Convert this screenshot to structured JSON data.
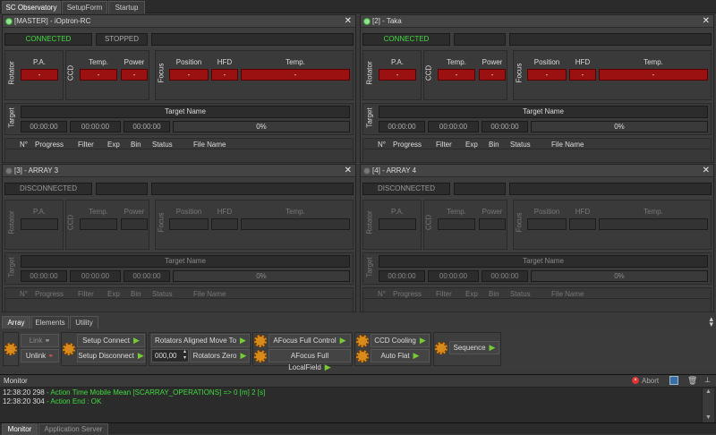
{
  "tabs": [
    "SC Observatory",
    "SetupForm",
    "Startup"
  ],
  "panels": [
    {
      "title": "[MASTER] - iOptron-RC",
      "status": "CONNECTED",
      "state": "STOPPED",
      "connected": true
    },
    {
      "title": "[2] - Taka",
      "status": "CONNECTED",
      "state": "",
      "connected": true
    },
    {
      "title": "[3] - ARRAY 3",
      "status": "DISCONNECTED",
      "state": "",
      "connected": false
    },
    {
      "title": "[4] - ARRAY 4",
      "status": "DISCONNECTED",
      "state": "",
      "connected": false
    }
  ],
  "labels": {
    "rotator": "Rotator",
    "pa": "P.A.",
    "ccd": "CCD",
    "temp": "Temp.",
    "power": "Power",
    "focus": "Focus",
    "position": "Position",
    "hfd": "HFD",
    "ftemp": "Temp.",
    "target": "Target",
    "target_name": "Target Name",
    "dash": "-",
    "time": "00:00:00",
    "progress": "0%"
  },
  "table_headers": [
    "N°",
    "Progress",
    "Filter",
    "Exp",
    "Bin",
    "Status",
    "File Name"
  ],
  "bottom_tabs": [
    "Array",
    "Elements",
    "Utility"
  ],
  "toolbar": {
    "link": "Link",
    "unlink": "Unlink",
    "setup_connect": "Setup Connect",
    "setup_disconnect": "Setup Disconnect",
    "rot_aligned": "Rotators Aligned Move To",
    "rot_value": "000,00",
    "rot_zero": "Rotators Zero",
    "afocus_control": "AFocus Full Control",
    "afocus_local": "AFocus Full LocalField",
    "ccd_cooling": "CCD Cooling",
    "auto_flat": "Auto Flat",
    "sequence": "Sequence"
  },
  "monitor": {
    "title": "Monitor",
    "abort": "Abort",
    "lines": [
      {
        "time": "12:38:20 298",
        "msg": " - Action Time Mobile Mean [SCARRAY_OPERATIONS] => 0 [m] 2 [s]"
      },
      {
        "time": "12:38:20 304",
        "msg": " - Action End : OK"
      }
    ]
  },
  "footer_tabs": [
    "Monitor",
    "Application Server"
  ],
  "colors": {
    "green": "#3fdc3f",
    "red": "#9b1010",
    "bg": "#3a3a3a"
  }
}
